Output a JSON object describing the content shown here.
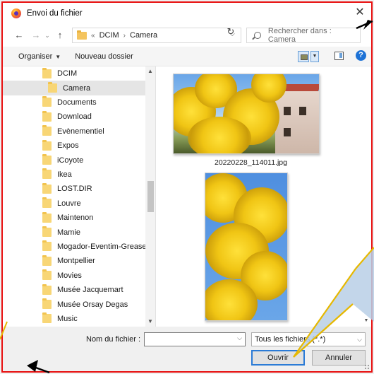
{
  "window": {
    "title": "Envoi du fichier"
  },
  "nav": {
    "address_segments": [
      "DCIM",
      "Camera"
    ],
    "address_prefix": "«",
    "search_placeholder": "Rechercher dans : Camera"
  },
  "toolbar": {
    "organize_label": "Organiser",
    "new_folder_label": "Nouveau dossier"
  },
  "tree": {
    "items": [
      {
        "label": "DCIM",
        "indent": 1,
        "selected": false
      },
      {
        "label": "Camera",
        "indent": 2,
        "selected": true
      },
      {
        "label": "Documents",
        "indent": 1,
        "selected": false
      },
      {
        "label": "Download",
        "indent": 1,
        "selected": false
      },
      {
        "label": "Evènementiel",
        "indent": 1,
        "selected": false
      },
      {
        "label": "Expos",
        "indent": 1,
        "selected": false
      },
      {
        "label": "iCoyote",
        "indent": 1,
        "selected": false
      },
      {
        "label": "Ikea",
        "indent": 1,
        "selected": false
      },
      {
        "label": "LOST.DIR",
        "indent": 1,
        "selected": false
      },
      {
        "label": "Louvre",
        "indent": 1,
        "selected": false
      },
      {
        "label": "Maintenon",
        "indent": 1,
        "selected": false
      },
      {
        "label": "Mamie",
        "indent": 1,
        "selected": false
      },
      {
        "label": "Mogador-Eventim-Grease",
        "indent": 1,
        "selected": false
      },
      {
        "label": "Montpellier",
        "indent": 1,
        "selected": false
      },
      {
        "label": "Movies",
        "indent": 1,
        "selected": false
      },
      {
        "label": "Musée Jacquemart",
        "indent": 1,
        "selected": false
      },
      {
        "label": "Musée Orsay Degas",
        "indent": 1,
        "selected": false
      },
      {
        "label": "Music",
        "indent": 1,
        "selected": false
      }
    ]
  },
  "files": {
    "items": [
      {
        "name": "20220228_114011.jpg"
      },
      {
        "name": ""
      }
    ]
  },
  "bottom": {
    "filename_label": "Nom du fichier :",
    "filename_value": "",
    "filetype_value": "Tous les fichiers (*.*)",
    "open_label": "Ouvrir",
    "cancel_label": "Annuler"
  },
  "colors": {
    "annotation_red": "#e81010",
    "callout_gold": "#e6b800",
    "selection": "#e5e5e5",
    "accent_blue": "#2b7bd6"
  }
}
